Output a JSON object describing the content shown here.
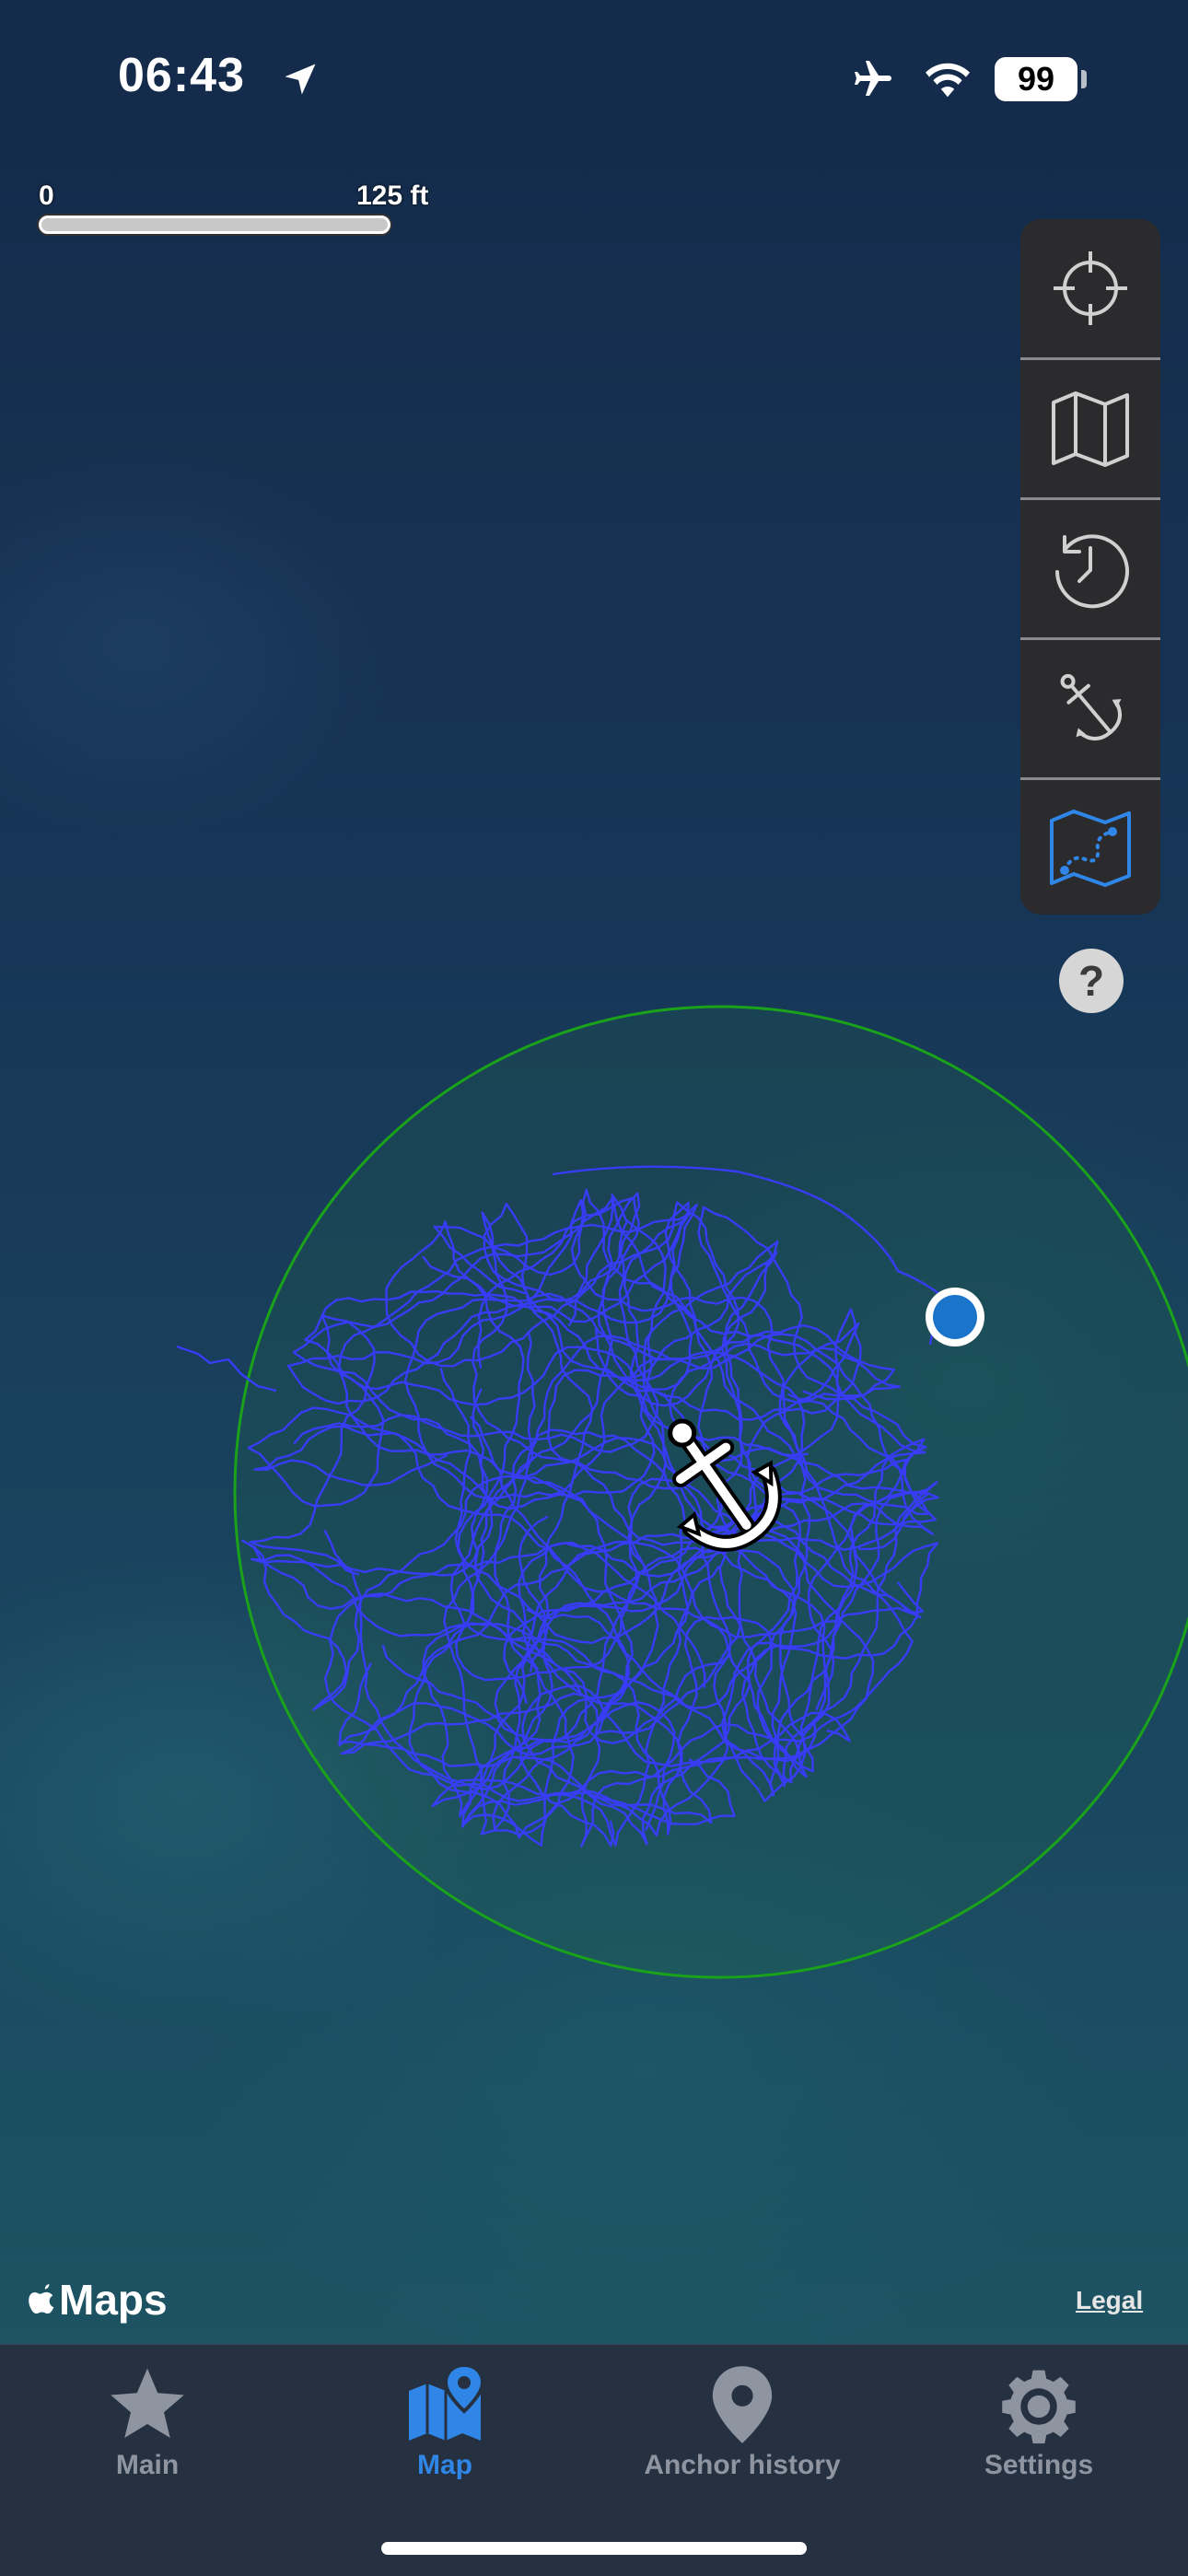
{
  "status_bar": {
    "time": "06:43",
    "battery": "99",
    "icons": [
      "location-arrow-icon",
      "airplane-icon",
      "wifi-icon",
      "battery-icon"
    ]
  },
  "scale": {
    "start_label": "0",
    "end_label": "125 ft"
  },
  "toolbar": {
    "buttons": [
      {
        "name": "recenter",
        "icon": "crosshair-icon"
      },
      {
        "name": "map-type",
        "icon": "map-icon"
      },
      {
        "name": "history",
        "icon": "history-clock-icon"
      },
      {
        "name": "drop-anchor",
        "icon": "anchor-drop-icon"
      },
      {
        "name": "track-map",
        "icon": "track-map-icon",
        "active": true
      }
    ]
  },
  "help": {
    "label": "?"
  },
  "map": {
    "attribution": "Maps",
    "legal": "Legal",
    "circle_color": "#1aa31a",
    "track_color": "#3a3cff",
    "boat_color": "#1a74c9"
  },
  "tabs": [
    {
      "label": "Main",
      "icon": "star-icon",
      "active": false
    },
    {
      "label": "Map",
      "icon": "map-pin-icon",
      "active": true
    },
    {
      "label": "Anchor history",
      "icon": "location-pin-icon",
      "active": false
    },
    {
      "label": "Settings",
      "icon": "gear-icon",
      "active": false
    }
  ],
  "colors": {
    "accent": "#2f86e6",
    "tab_inactive": "#8e95a1"
  }
}
